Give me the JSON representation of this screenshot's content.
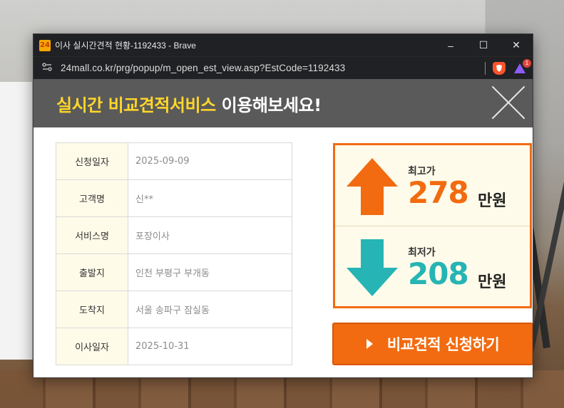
{
  "window": {
    "favicon_text": "24",
    "title": "이사 실시간견적 현황-1192433 - Brave",
    "controls": {
      "minimize": "–",
      "maximize": "☐",
      "close": "✕"
    }
  },
  "address_bar": {
    "url": "24mall.co.kr/prg/popup/m_open_est_view.asp?EstCode=1192433",
    "rewards_badge": "1"
  },
  "banner": {
    "highlight": "실시간 비교견적서비스",
    "rest": "이용해보세요!"
  },
  "info_table": [
    {
      "label": "신청일자",
      "value": "2025-09-09"
    },
    {
      "label": "고객명",
      "value": "신**"
    },
    {
      "label": "서비스명",
      "value": "포장이사"
    },
    {
      "label": "출발지",
      "value": "인천 부평구 부개동"
    },
    {
      "label": "도착지",
      "value": "서울 송파구 잠실동"
    },
    {
      "label": "이사일자",
      "value": "2025-10-31"
    }
  ],
  "prices": {
    "high": {
      "label": "최고가",
      "value": "278",
      "unit": "만원",
      "color": "#f26b10"
    },
    "low": {
      "label": "최저가",
      "value": "208",
      "unit": "만원",
      "color": "#26b4b4"
    }
  },
  "apply_button": {
    "label": "비교견적 신청하기",
    "color": "#f26b10"
  },
  "icons": [
    "site-settings-icon",
    "brave-shield-icon",
    "brave-rewards-icon",
    "arrow-up-icon",
    "arrow-down-icon",
    "play-icon",
    "close-icon"
  ]
}
